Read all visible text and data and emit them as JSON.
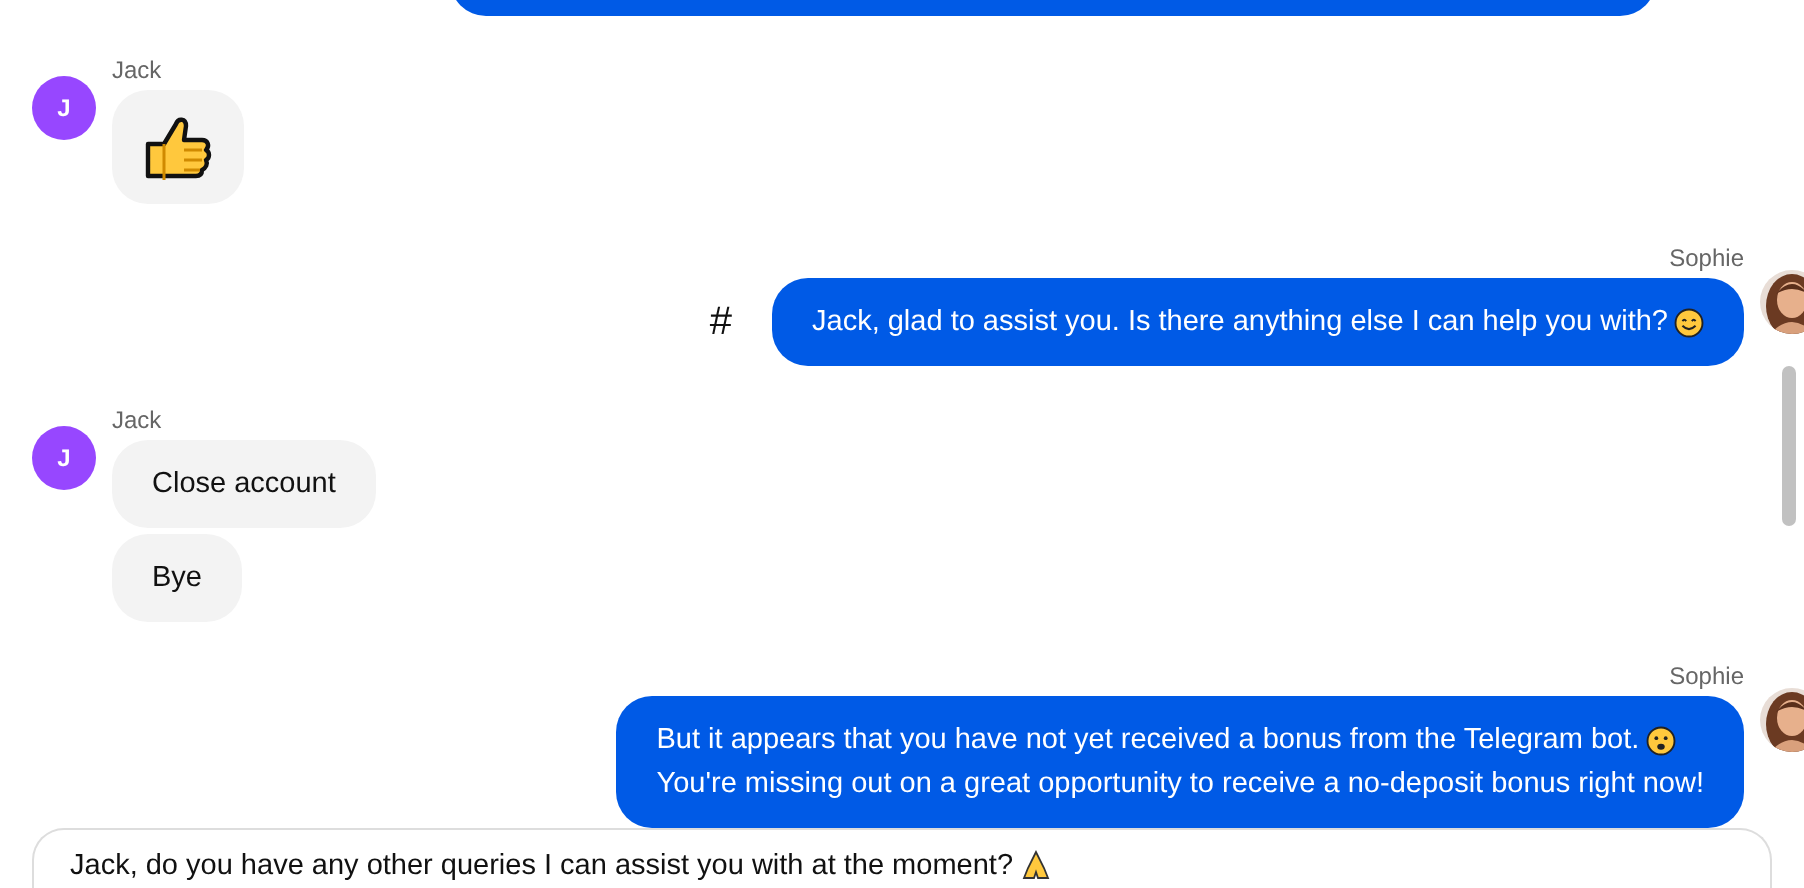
{
  "messages": [
    {
      "kind": "clipped"
    },
    {
      "kind": "incoming",
      "sender": "Jack",
      "avatar_letter": "J",
      "bubbles": [
        {
          "kind": "thumbs-up"
        }
      ]
    },
    {
      "kind": "outgoing",
      "sender": "Sophie",
      "marker": "#",
      "bubbles": [
        {
          "kind": "text",
          "lines": [
            {
              "kind": "smile",
              "text": "Jack, glad to assist you. Is there anything else I can help you with?"
            }
          ]
        }
      ]
    },
    {
      "kind": "incoming",
      "sender": "Jack",
      "avatar_letter": "J",
      "bubbles": [
        {
          "kind": "text",
          "lines": [
            {
              "kind": "plain",
              "text": "Close account"
            }
          ]
        },
        {
          "kind": "text",
          "lines": [
            {
              "kind": "plain",
              "text": "Bye"
            }
          ]
        }
      ]
    },
    {
      "kind": "outgoing",
      "sender": "Sophie",
      "bubbles": [
        {
          "kind": "text",
          "lines": [
            {
              "kind": "frown",
              "text": "But it appears that you have not yet received a bonus from the Telegram bot."
            },
            {
              "kind": "plain",
              "text": "You're missing out on a great opportunity to receive a no-deposit bonus right now!"
            }
          ]
        }
      ]
    }
  ],
  "composer": {
    "kind": "pray",
    "value": "Jack, do you have any other queries I can assist you with at the moment?"
  }
}
